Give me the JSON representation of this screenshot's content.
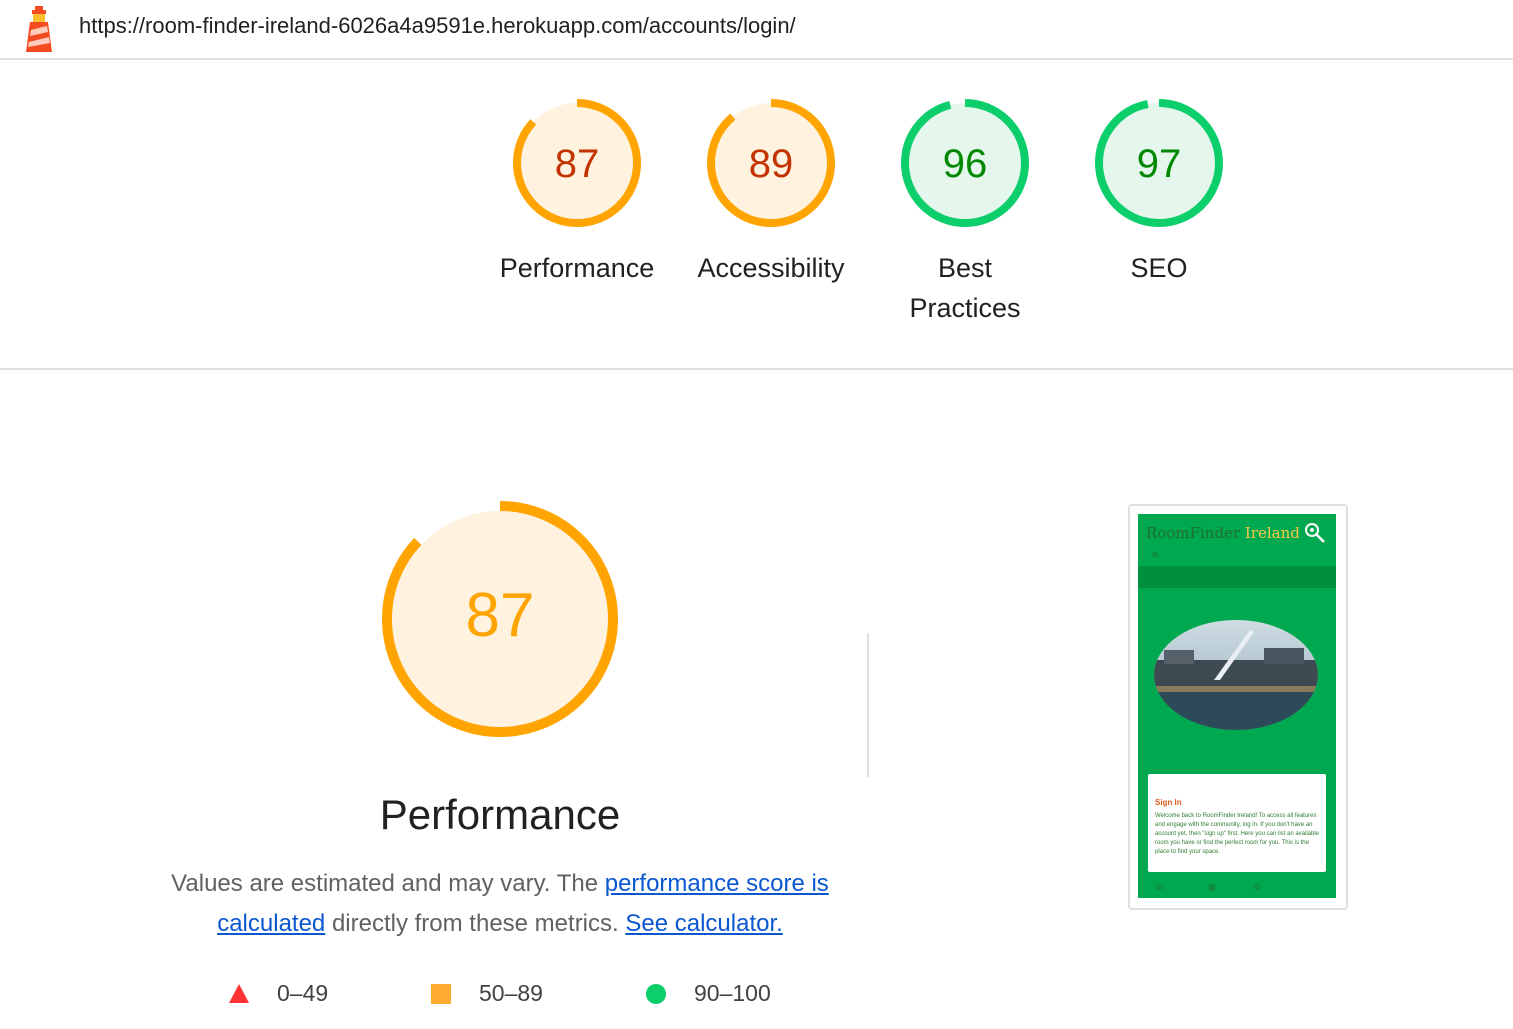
{
  "header": {
    "url": "https://room-finder-ireland-6026a4a9591e.herokuapp.com/accounts/login/",
    "logo_icon": "lighthouse-icon"
  },
  "colors": {
    "average": "#ffa400",
    "average_bg": "#fff3e0",
    "average_text": "#c33300",
    "pass": "#0cce6b",
    "pass_bg": "#e5f7ed",
    "pass_text": "#008800",
    "fail": "#ff3333",
    "link": "#0b57d0"
  },
  "scores": [
    {
      "label": "Performance",
      "score": "87",
      "value": 87,
      "rating": "average"
    },
    {
      "label": "Accessibility",
      "score": "89",
      "value": 89,
      "rating": "average"
    },
    {
      "label": "Best Practices",
      "score": "96",
      "value": 96,
      "rating": "pass"
    },
    {
      "label": "SEO",
      "score": "97",
      "value": 97,
      "rating": "pass"
    }
  ],
  "performance": {
    "title": "Performance",
    "score": "87",
    "value": 87,
    "desc_prefix": "Values are estimated and may vary. The ",
    "desc_link": "performance score is calculated",
    "desc_middle": " directly from these metrics. ",
    "calc_link": "See calculator."
  },
  "legend": [
    {
      "range": "0–49",
      "symbol": "triangle-icon"
    },
    {
      "range": "50–89",
      "symbol": "square-icon"
    },
    {
      "range": "90–100",
      "symbol": "circle-icon"
    }
  ],
  "thumbnail": {
    "brand_a": "RoomFinder",
    "brand_b": "Ireland",
    "menu": "≡",
    "card_title": "Sign In",
    "card_text": "Welcome back to RoomFinder Ireland! To access all features and engage with the community, log in. If you don't have an account yet, then \"sign up\" first. Here you can list an available room you have or find the perfect room for you. This is the place to find your space.",
    "footer_icons": [
      "linkedin-icon",
      "github-icon",
      "copyright-icon"
    ]
  }
}
